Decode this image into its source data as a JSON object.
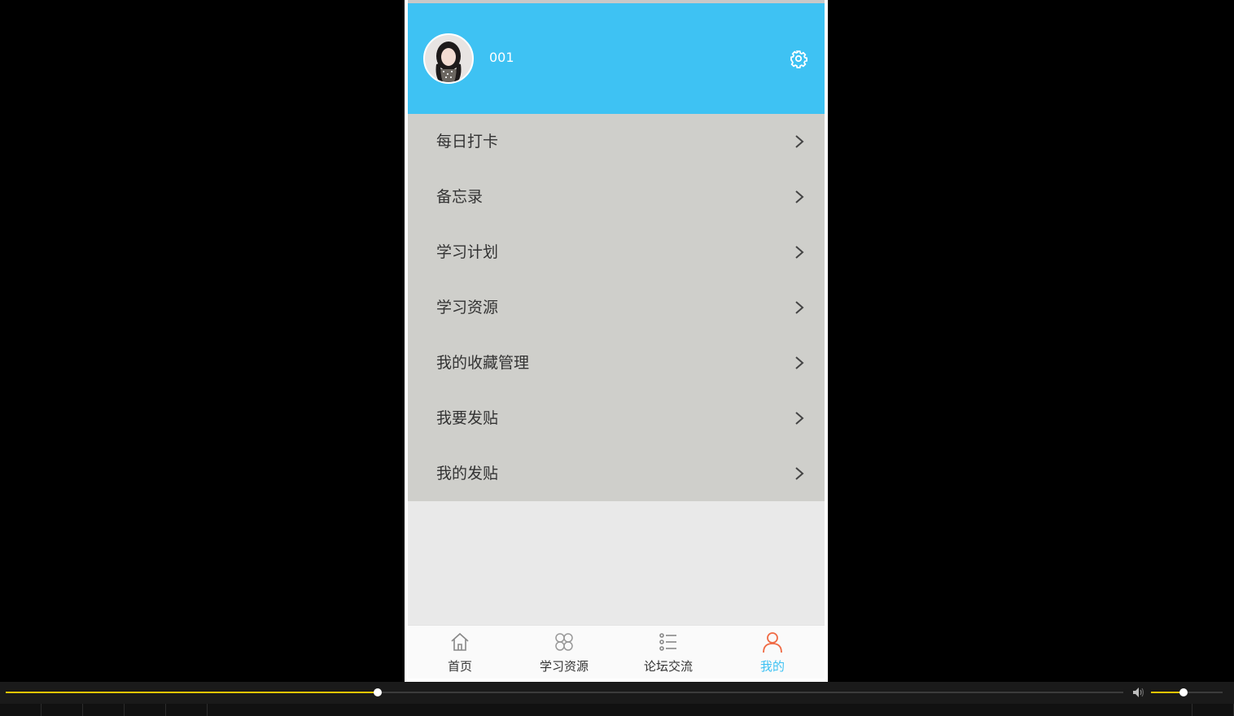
{
  "profile": {
    "username": "001",
    "avatar_icon": "avatar-portrait",
    "settings_icon": "gear-icon",
    "header_color": "#3ec2f3"
  },
  "menu": {
    "items": [
      {
        "label": "每日打卡"
      },
      {
        "label": "备忘录"
      },
      {
        "label": "学习计划"
      },
      {
        "label": "学习资源"
      },
      {
        "label": "我的收藏管理"
      },
      {
        "label": "我要发贴"
      },
      {
        "label": "我的发贴"
      }
    ],
    "chevron_icon": "chevron-right-icon"
  },
  "tabbar": {
    "tabs": [
      {
        "label": "首页",
        "icon": "home-icon",
        "active": false
      },
      {
        "label": "学习资源",
        "icon": "grid-icon",
        "active": false
      },
      {
        "label": "论坛交流",
        "icon": "list-icon",
        "active": false
      },
      {
        "label": "我的",
        "icon": "user-icon",
        "active": true
      }
    ],
    "active_color": "#3ec2f3",
    "active_icon_color": "#f06b45"
  },
  "player": {
    "progress_fraction": 0.333,
    "volume_fraction": 0.45,
    "accent_color": "#f2c500",
    "volume_icon": "speaker-icon"
  }
}
